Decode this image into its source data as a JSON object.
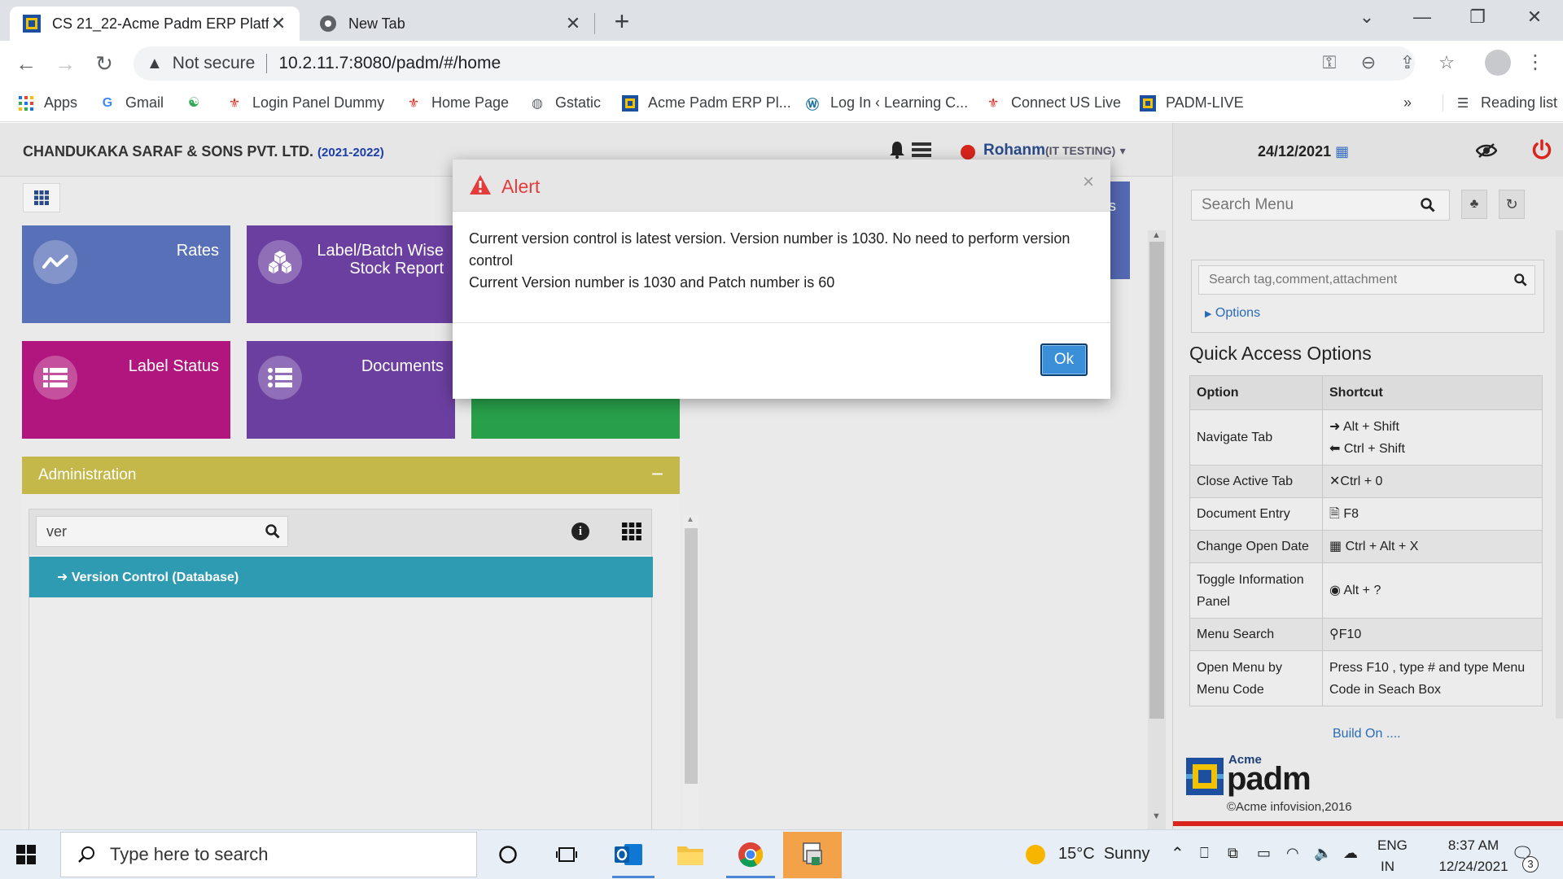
{
  "browser": {
    "tabs": [
      {
        "title": "CS 21_22-Acme Padm ERP Platfo"
      },
      {
        "title": "New Tab"
      }
    ],
    "address": {
      "security": "Not secure",
      "url": "10.2.11.7:8080/padm/#/home"
    },
    "bookmarks": [
      "Apps",
      "Gmail",
      "",
      "Login Panel Dummy",
      "Home Page",
      "Gstatic",
      "Acme Padm ERP Pl...",
      "Log In ‹ Learning C...",
      "Connect US Live",
      "PADM-LIVE"
    ],
    "more_bookmarks": "»",
    "reading_list": "Reading list"
  },
  "app": {
    "company": "CHANDUKAKA SARAF & SONS PVT. LTD.",
    "year": "(2021-2022)",
    "user": "Rohanm",
    "user_role": "(IT TESTING)",
    "tiles": [
      {
        "label": "Rates",
        "color": "#5870b8"
      },
      {
        "label": "Label/Batch Wise Stock Report",
        "color": "#6b3fa0"
      },
      {
        "label": "Label Status",
        "color": "#b0167e"
      },
      {
        "label": "Documents",
        "color": "#6b3fa0"
      },
      {
        "label": "",
        "color": "#28a04a"
      }
    ],
    "tile_edge_text": "s",
    "admin": {
      "title": "Administration",
      "collapse": "−",
      "search_value": "ver",
      "result": "Version Control (Database)"
    }
  },
  "sidebar": {
    "date": "24/12/2021",
    "search_placeholder": "Search Menu",
    "tag_placeholder": "Search tag,comment,attachment",
    "options": "Options",
    "quick_title": "Quick Access Options",
    "table_headers": [
      "Option",
      "Shortcut"
    ],
    "rows": [
      {
        "option": "Navigate Tab",
        "shortcut": [
          "Alt + Shift",
          "Ctrl + Shift"
        ]
      },
      {
        "option": "Close Active Tab",
        "shortcut": [
          "Ctrl + 0"
        ]
      },
      {
        "option": "Document Entry",
        "shortcut": [
          "F8"
        ]
      },
      {
        "option": "Change Open Date",
        "shortcut": [
          "Ctrl + Alt + X"
        ]
      },
      {
        "option": "Toggle Information Panel",
        "shortcut": [
          "Alt + ?"
        ]
      },
      {
        "option": "Menu Search",
        "shortcut": [
          "F10"
        ]
      },
      {
        "option": "Open Menu by Menu Code",
        "shortcut": [
          "Press F10 , type # and type Menu Code in Seach Box"
        ]
      }
    ],
    "build": "Build On ....",
    "logo_top": "Acme",
    "logo_main": "padm",
    "copyright": "©Acme infovision,2016"
  },
  "modal": {
    "title": "Alert",
    "close": "×",
    "line1": "Current version control is latest version. Version number is 1030. No need to perform version control",
    "line2": "Current Version number is 1030 and Patch number is 60",
    "ok": "Ok"
  },
  "taskbar": {
    "search_placeholder": "Type here to search",
    "weather_temp": "15°C",
    "weather_desc": "Sunny",
    "lang1": "ENG",
    "lang2": "IN",
    "time": "8:37 AM",
    "date": "12/24/2021",
    "notif_count": "3"
  },
  "colors": {
    "accent": "#3a8fd8",
    "alert": "#e23c3c",
    "admin": "#c4b84a",
    "result_row": "#2f9bb3"
  }
}
